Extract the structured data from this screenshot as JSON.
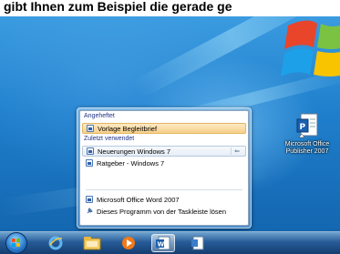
{
  "caption": {
    "text": "gibt Ihnen zum Beispiel die gerade ge"
  },
  "desktop": {
    "icon": {
      "name": "word-shortcut-icon",
      "label": "Microsoft Office Publisher 2007"
    }
  },
  "jumplist": {
    "pinned_heading": "Angeheftet",
    "pinned_items": [
      {
        "label": "Vorlage Begleitbrief"
      }
    ],
    "recent_heading": "Zuletzt verwendet",
    "recent_items": [
      {
        "label": "Neuerungen Windows 7"
      },
      {
        "label": "Ratgeber - Windows 7"
      }
    ],
    "tasks": [
      {
        "label": "Microsoft Office Word 2007"
      },
      {
        "label": "Dieses Programm von der Taskleiste lösen"
      }
    ]
  },
  "taskbar": {
    "buttons": [
      {
        "name": "internet-explorer-icon"
      },
      {
        "name": "explorer-folder-icon"
      },
      {
        "name": "media-player-icon"
      },
      {
        "name": "word-icon"
      },
      {
        "name": "windows-document-icon"
      }
    ]
  },
  "colors": {
    "desktop": "#1f7fcc",
    "heading": "#1e3287",
    "highlight": "#f7d08a"
  }
}
